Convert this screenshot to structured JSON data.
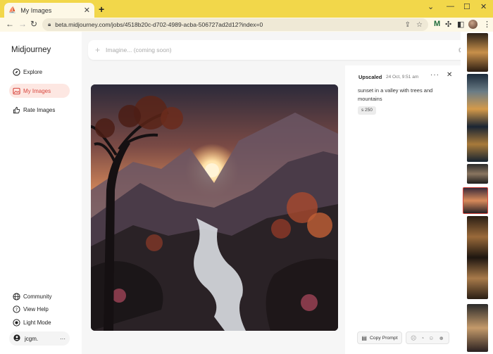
{
  "browser": {
    "tab_title": "My Images",
    "url": "beta.midjourney.com/jobs/4518b20c-d702-4989-acba-506727ad2d12?index=0"
  },
  "sidebar": {
    "brand": "Midjourney",
    "items": [
      {
        "label": "Explore",
        "icon": "compass-icon"
      },
      {
        "label": "My Images",
        "icon": "image-icon",
        "active": true
      },
      {
        "label": "Rate Images",
        "icon": "thumbs-up-icon"
      }
    ],
    "bottom_items": [
      {
        "label": "Community",
        "icon": "globe-icon"
      },
      {
        "label": "View Help",
        "icon": "help-circle-icon"
      },
      {
        "label": "Light Mode",
        "icon": "sun-icon"
      }
    ],
    "user": "jcgm."
  },
  "search": {
    "placeholder": "Imagine... (coming soon)"
  },
  "detail": {
    "status": "Upscaled",
    "timestamp": "24 Oct, 9:51 am",
    "prompt": "sunset in a valley with trees and mountains",
    "seed_badge": "s 250",
    "copy_prompt_label": "Copy Prompt",
    "rating_icons": [
      "dislike-face-icon",
      "neutral-face-icon",
      "like-face-icon",
      "love-face-icon"
    ]
  },
  "colors": {
    "accent": "#d8473f",
    "active_bg": "#fde7e2",
    "browser_frame": "#f2d74a"
  }
}
